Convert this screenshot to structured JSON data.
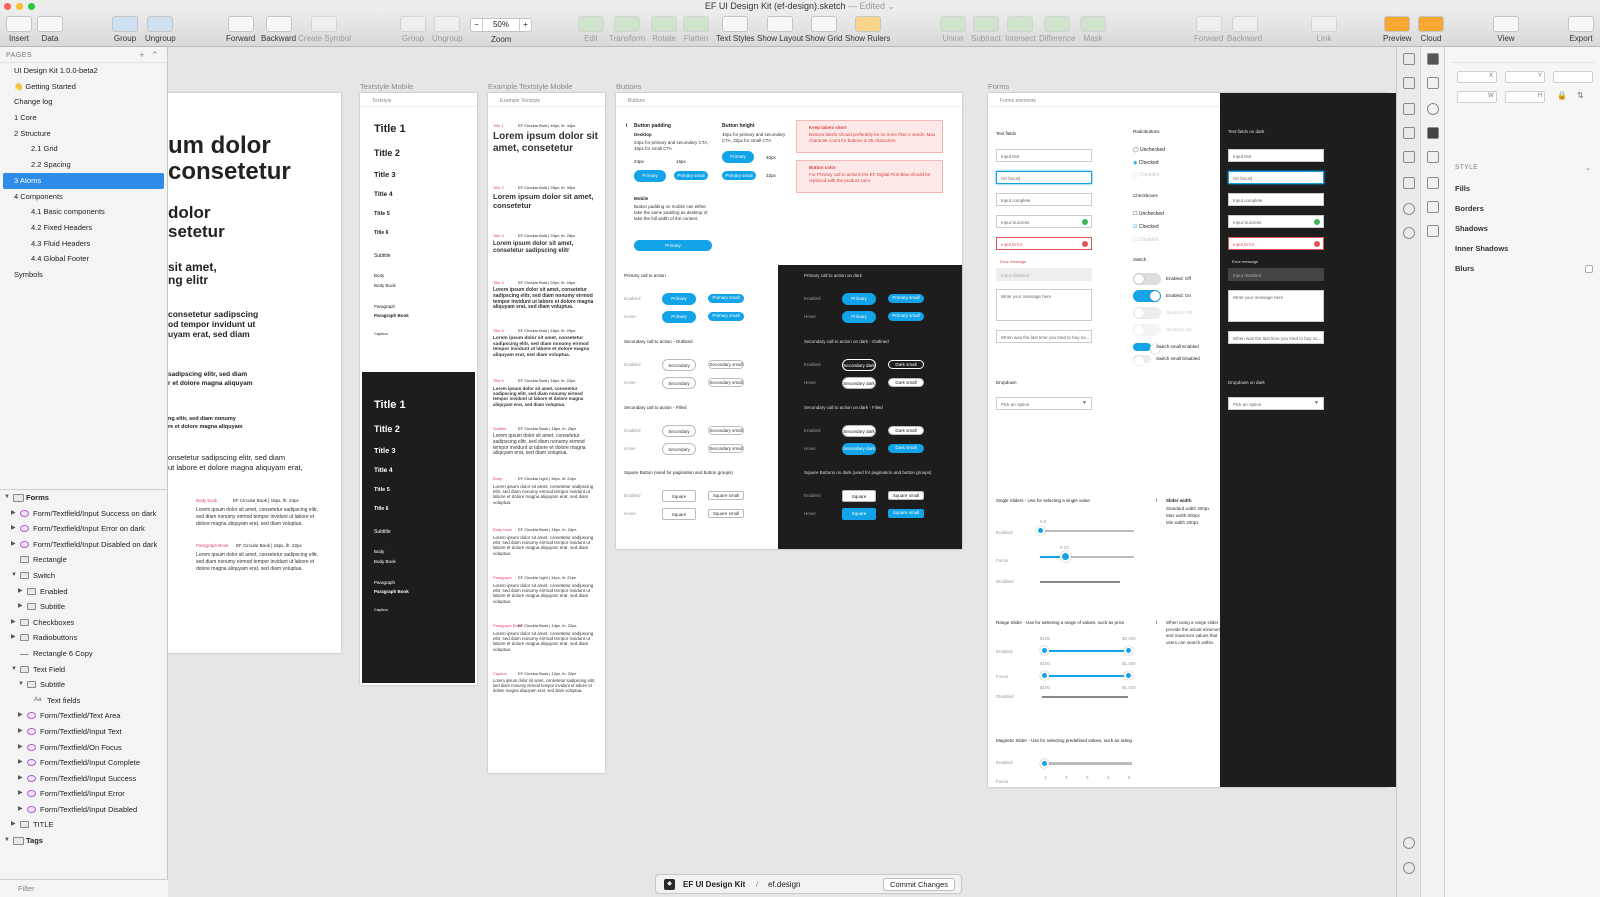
{
  "window": {
    "title": "EF UI Design Kit (ef-design).sketch",
    "status": "— Edited ⌄"
  },
  "toolbar": {
    "insert": "Insert",
    "data": "Data",
    "group": "Group",
    "ungroup": "Ungroup",
    "forward": "Forward",
    "backward": "Backward",
    "create_symbol": "Create Symbol",
    "group2": "Group",
    "ungroup2": "Ungroup",
    "zoom_value": "50%",
    "zoom": "Zoom",
    "edit": "Edit",
    "transform": "Transform",
    "rotate": "Rotate",
    "flatten": "Flatten",
    "text_styles": "Text Styles",
    "show_layout": "Show Layout",
    "show_grid": "Show Grid",
    "show_rulers": "Show Rulers",
    "union": "Union",
    "subtract": "Subtract",
    "intersect": "Intersect",
    "difference": "Difference",
    "mask": "Mask",
    "forward2": "Forward",
    "backward2": "Backward",
    "link": "Link",
    "preview": "Preview",
    "cloud": "Cloud",
    "view": "View",
    "export": "Export"
  },
  "pages": {
    "header": "PAGES",
    "items": [
      "UI Design Kit 1.0.0-beta2",
      "👋 Getting Started",
      "Change log",
      "1 Core",
      "2 Structure",
      "2.1 Grid",
      "2.2 Spacing",
      "3 Atoms",
      "4 Components",
      "4.1 Basic components",
      "4.2 Fixed Headers",
      "4.3 Fluid Headers",
      "4.4 Global Footer",
      "Symbols"
    ],
    "selected": "3 Atoms"
  },
  "layers": [
    {
      "label": "Forms",
      "level": 0,
      "icon": "artboard",
      "open": true
    },
    {
      "label": "Form/Textfield/Input Success on dark",
      "level": 1,
      "icon": "symbol"
    },
    {
      "label": "Form/Textfield/Input Error on dark",
      "level": 1,
      "icon": "symbol"
    },
    {
      "label": "Form/Textfield/Input Disabled on dark",
      "level": 1,
      "icon": "symbol"
    },
    {
      "label": "Rectangle",
      "level": 1,
      "icon": "rect"
    },
    {
      "label": "Switch",
      "level": 1,
      "icon": "folder",
      "open": true
    },
    {
      "label": "Enabled",
      "level": 2,
      "icon": "folder"
    },
    {
      "label": "Subtitle",
      "level": 2,
      "icon": "folder"
    },
    {
      "label": "Checkboxes",
      "level": 1,
      "icon": "folder"
    },
    {
      "label": "Radiobuttons",
      "level": 1,
      "icon": "folder"
    },
    {
      "label": "Rectangle 6 Copy",
      "level": 1,
      "icon": "line"
    },
    {
      "label": "Text Field",
      "level": 1,
      "icon": "folder",
      "open": true
    },
    {
      "label": "Subtitle",
      "level": 2,
      "icon": "folder",
      "open": true
    },
    {
      "label": "Text fields",
      "level": 3,
      "icon": "text"
    },
    {
      "label": "Form/Textfield/Text Area",
      "level": 2,
      "icon": "symbol"
    },
    {
      "label": "Form/Textfield/Input Text",
      "level": 2,
      "icon": "symbol"
    },
    {
      "label": "Form/Textfield/On Focus",
      "level": 2,
      "icon": "symbol"
    },
    {
      "label": "Form/Textfield/Input Complete",
      "level": 2,
      "icon": "symbol"
    },
    {
      "label": "Form/Textfield/Input Success",
      "level": 2,
      "icon": "symbol"
    },
    {
      "label": "Form/Textfield/Input Error",
      "level": 2,
      "icon": "symbol"
    },
    {
      "label": "Form/Textfield/Input Disabled",
      "level": 2,
      "icon": "symbol"
    },
    {
      "label": "TITLE",
      "level": 1,
      "icon": "folder"
    },
    {
      "label": "Tags",
      "level": 0,
      "icon": "artboard",
      "open": true
    }
  ],
  "filter_placeholder": "Filter",
  "artboards": {
    "textstyle_mobile": "Textstyle Mobile",
    "example_textstyle_mobile": "Example Textstyle Mobile",
    "buttons": "Buttons",
    "forms": "Forms"
  },
  "first_board": {
    "h1": "um dolor\nconsetetur",
    "h2": "dolor\nsetetur",
    "h3": "sit amet,\nng elitr",
    "h4": "consetetur sadipscing\nod tempor invidunt ut\nuyam erat, sed diam",
    "h5": "sadipscing elitr, sed diam\nr et dolore magna aliquyam",
    "h6": "ng elitr, sed diam nonumy\nre et dolore magna aliquyam",
    "body": "onsetetur sadipscing elitr, sed diam\nut labore et dolore magna aliquyam erat,",
    "label1": "Body book",
    "label1b": "EF Circular Book | 16px, lh: 24px",
    "label2": "Paragraph Book",
    "label2b": "EF Circular Book | 16px, lh: 22px",
    "p1": "Lorem ipsum dolor sit amet, consetetur sadipscing elitr, sed diam nonumy eirmod tempor invidunt ut labore et dolore magna aliquyam erat, sed diam voluptua.",
    "p2": "Lorem ipsum dolor sit amet, consetetur sadipscing elitr, sed diam nonumy eirmod tempor invidunt ut labore et dolore magna aliquyam erat, sed diam voluptua."
  },
  "textstyle": {
    "head": "Textstyle",
    "items": [
      "Title 1",
      "Title 2",
      "Title 3",
      "Title 4",
      "Title 5",
      "Title 6",
      "Subtitle",
      "Body",
      "Body Book",
      "Paragraph",
      "Paragraph Book",
      "Caption"
    ],
    "dark_items": [
      "Title 1",
      "Title 2",
      "Title 3",
      "Title 4",
      "Title 5",
      "Title 6",
      "Subtitle",
      "Body",
      "Body Book",
      "Paragraph",
      "Paragraph Book",
      "Caption"
    ]
  },
  "example": {
    "head": "Example Textstyle",
    "blocks": [
      {
        "tag": "Title 1",
        "spec": "EF Circular Bold | 40px, lh: 44px",
        "text": "Lorem ipsum dolor sit amet, consetetur"
      },
      {
        "tag": "Title 2",
        "spec": "EF Circular Bold | 28px, lh: 30px",
        "text": "Lorem ipsum dolor sit amet, consetetur"
      },
      {
        "tag": "Title 3",
        "spec": "EF Circular Bold | 24px, lh: 28px",
        "text": "Lorem ipsum dolor sit amet, consetetur sadipscing elitr"
      },
      {
        "tag": "Title 4",
        "spec": "EF Circular Bold | 20px, lh: 24px",
        "text": "Lorem ipsum dolor sit amet, consetetur sadipscing elitr, sed diam nonumy eirmod tempor invidunt ut labore et dolore magna aliquyam erat, sed diam voluptua."
      },
      {
        "tag": "Title 5",
        "spec": "EF Circular Bold | 18px, lh: 20px",
        "text": "Lorem ipsum dolor sit amet, consetetur sadipscing elitr, sed diam nonumy eirmod tempor invidunt ut labore et dolore magna aliquyam erat, sed diam voluptua."
      },
      {
        "tag": "Title 6",
        "spec": "EF Circular Bold | 16px, lh: 22px",
        "text": "Lorem ipsum dolor sit amet, consetetur sadipscing elitr, sed diam nonumy eirmod tempor invidunt ut labore et dolore magna aliquyam erat, sed diam voluptua."
      },
      {
        "tag": "Subtitle",
        "spec": "EF Circular Book | 18px, lh: 25px",
        "text": "Lorem ipsum dolor sit amet, consetetur sadipscing elitr, sed diam nonumy eirmod tempor invidunt ut labore et dolore magna aliquyam erat, sed diam voluptua."
      },
      {
        "tag": "Body",
        "spec": "EF Circular Light | 16px, lh: 24px",
        "text": "Lorem ipsum dolor sit amet, consetetur sadipscing elitr, sed diam nonumy eirmod tempor invidunt ut labore et dolore magna aliquyam erat, sed diam voluptua."
      },
      {
        "tag": "Body book",
        "spec": "EF Circular Book | 16px, lh: 24px",
        "text": "Lorem ipsum dolor sit amet, consetetur sadipscing elitr, sed diam nonumy eirmod tempor invidunt ut labore et dolore magna aliquyam erat, sed diam voluptua."
      },
      {
        "tag": "Paragraph",
        "spec": "EF Circular Light | 14px, lh: 22px",
        "text": "Lorem ipsum dolor sit amet, consetetur sadipscing elitr, sed diam nonumy eirmod tempor invidunt ut labore et dolore magna aliquyam erat, sed diam voluptua."
      },
      {
        "tag": "Paragraph Book",
        "spec": "EF Circular Book | 14px, lh: 22px",
        "text": "Lorem ipsum dolor sit amet, consetetur sadipscing elitr, sed diam nonumy eirmod tempor invidunt ut labore et dolore magna aliquyam erat, sed diam voluptua."
      },
      {
        "tag": "Caption",
        "spec": "EF Circular Book | 12px, lh: 22px",
        "text": "Lorem ipsum dolor sit amet, consetetur sadipscing elitr, sed diam nonumy eirmod tempor invidunt ut labore et dolore magna aliquyam erat, sed diam voluptua."
      }
    ]
  },
  "buttons": {
    "head": "Buttons",
    "padding_title": "Button padding",
    "padding_desktop": "Desktop",
    "padding_desc": "24px for primary and secondary CTA, 16px for small CTA",
    "px24": "24px",
    "px16": "16px",
    "height_title": "Button height",
    "height_desc": "40px for primary and secondary CTA, 32px for small CTA",
    "px40": "40px",
    "px32": "32px",
    "mobile_title": "Mobile",
    "mobile_desc": "Button padding on mobile can either take the same padding as desktop of take the full width of the content.",
    "alert1_title": "Keep labels short",
    "alert1_text": "Buttons labels should preferably be no more than 2 words. Max character count for buttons is 35 characters.",
    "alert2_title": "Button color",
    "alert2_text": "For Primary call to actions the EF Digital First Blue should be replaced with the product color.",
    "primary": "Primary",
    "primary_small": "Primary small",
    "sec_primary": "Primary call to action",
    "sec_primary_dark": "Primary call to action on dark",
    "sec_outlined": "Secondary call to action - Outlined",
    "sec_outlined_dark": "Secondary call to action on dark - Outlined",
    "sec_filled": "Secondary call to action - Filled",
    "sec_filled_dark": "Secondary call to action on dark - Filled",
    "sec_square": "Square Button (used for pagination and button groups)",
    "sec_square_dark": "Square Buttons on dark (used for pagination and button groups)",
    "enabled": "Enabled",
    "hover": "Hover",
    "secondary": "Secondary",
    "secondary_small": "Secondary small",
    "secondary_dark": "Secondary dark",
    "dark_small": "Dark small",
    "square": "Square",
    "square_small": "Square small"
  },
  "forms": {
    "head": "Forms elements",
    "text_fields": "Text fields",
    "fields": [
      "Input text",
      "On focus|",
      "Input complete",
      "Input Success",
      "Input Error",
      "Input disabled"
    ],
    "error_message": "Error message",
    "textarea": "Write your message here",
    "long_input": "When was the last time you tried to buy so...",
    "radio_title": "Radiobuttons",
    "unchecked": "Unchecked",
    "checked": "Checked",
    "disabled": "Disabled",
    "check_title": "Checkboxes",
    "switch_title": "Switch",
    "enabled_off": "Enabled: Off",
    "enabled_on": "Enabled: On",
    "disabled_off": "Disabled: Off",
    "disabled_on": "Disabled: On",
    "switch_small_enabled": "Switch small Enabled",
    "switch_small_disabled": "Switch small Disabled",
    "dark_title": "Text fields on dark",
    "dropdown_title": "Dropdown",
    "dropdown_dark_title": "Dropdown on dark",
    "dropdown_value": "Pick an option",
    "single_slider": "Single Sliders - Use for selecting a single value",
    "slider_width_title": "Slider width",
    "slider_width_text": "Standard width 300px\nMax width 600px\nMin width 200px",
    "range_slider": "Range Slider - Use for selecting a range of values, such as price",
    "range_note": "When using a range slider provide the actual minimum and maximum values that users can search within.",
    "magnetic": "Magnetic Slider - Use for selecting predefined values, such as rating",
    "enabled": "Enabled",
    "focus": "Focus",
    "v0": "0.0",
    "v1": "0.33",
    "r_min": "$100",
    "r_max": "$2,400",
    "r_max2": "$1,400",
    "ticks": [
      "1",
      "2",
      "3",
      "4",
      "5"
    ]
  },
  "bottom": {
    "project": "EF UI Design Kit",
    "sep": "/",
    "repo": "ef.design",
    "commit": "Commit Changes"
  },
  "inspector": {
    "x": "X",
    "y": "Y",
    "w": "W",
    "h": "H",
    "style": "STYLE",
    "fills": "Fills",
    "borders": "Borders",
    "shadows": "Shadows",
    "inner_shadows": "Inner Shadows",
    "blurs": "Blurs"
  },
  "colors": {
    "accent": "#12a3e8",
    "selection": "#2d8ce8",
    "error": "#e0407b",
    "dark_board": "#1d1d1d"
  }
}
